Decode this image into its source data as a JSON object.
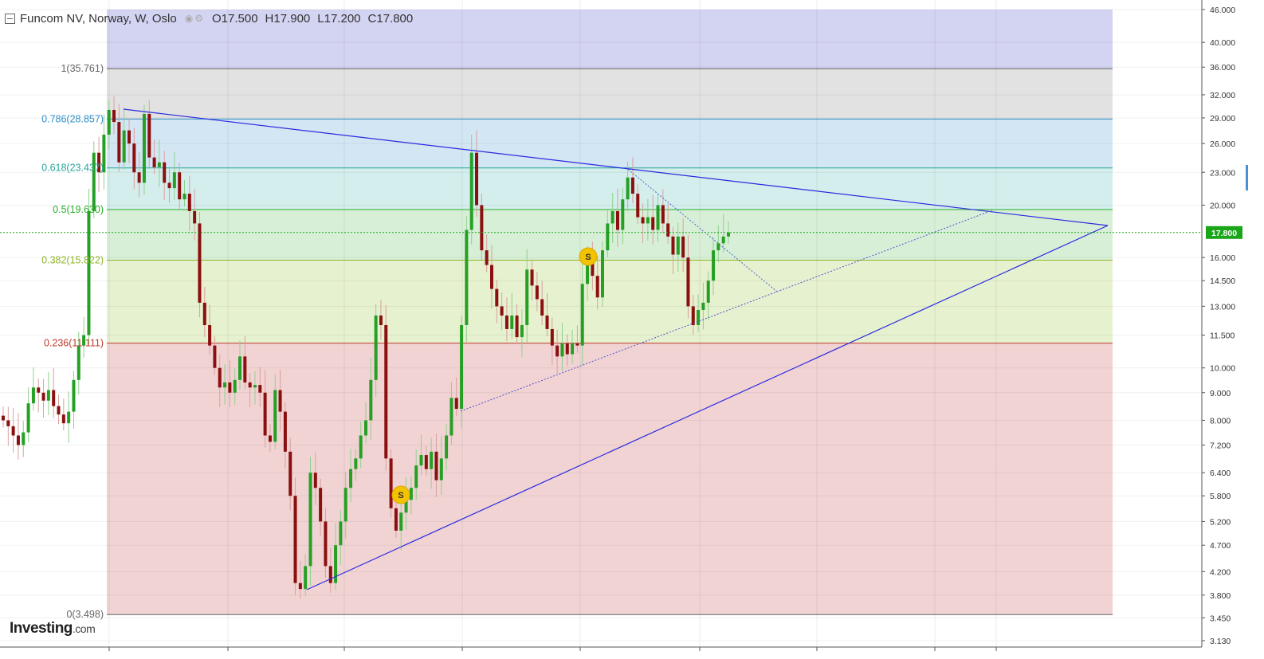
{
  "header": {
    "symbol": "Funcom NV, Norway, W, Oslo",
    "open_label": "O",
    "open": "17.500",
    "high_label": "H",
    "high": "17.900",
    "low_label": "L",
    "low": "17.200",
    "close_label": "C",
    "close": "17.800"
  },
  "branding": {
    "name": "Investing",
    "suffix": ".com"
  },
  "chart_data": {
    "type": "candlestick",
    "title": "Funcom NV, Norway, W, Oslo",
    "y_scale": "log",
    "ylim": [
      3.13,
      46.0
    ],
    "y_ticks": [
      "46.000",
      "40.000",
      "36.000",
      "32.000",
      "29.000",
      "26.000",
      "23.000",
      "20.000",
      "16.000",
      "14.500",
      "13.000",
      "11.500",
      "10.000",
      "9.000",
      "8.000",
      "7.200",
      "6.400",
      "5.800",
      "5.200",
      "4.700",
      "4.200",
      "3.800",
      "3.450",
      "3.130"
    ],
    "last_price": "17.800",
    "fibonacci": [
      {
        "label": "1(35.761)",
        "level": 35.761,
        "color": "#666666"
      },
      {
        "label": "0.786(28.857)",
        "level": 28.857,
        "color": "#2f8fc9"
      },
      {
        "label": "0.618(23.437)",
        "level": 23.437,
        "color": "#26a69a"
      },
      {
        "label": "0.5(19.630)",
        "level": 19.63,
        "color": "#27ae27"
      },
      {
        "label": "0.382(15.822)",
        "level": 15.822,
        "color": "#8fb528"
      },
      {
        "label": "0.236(11.111)",
        "level": 11.111,
        "color": "#c0392b"
      },
      {
        "label": "0(3.498)",
        "level": 3.498,
        "color": "#666666"
      }
    ],
    "fib_zones": [
      "#d3d3f2",
      "#e2e2e2",
      "#d3e6f3",
      "#d3eeec",
      "#d8efd7",
      "#e6f1cf",
      "#f1d3d3"
    ],
    "signals": [
      "S",
      "S"
    ],
    "series": [
      {
        "name": "Funcom NV",
        "weekly_closes": [
          8.0,
          7.8,
          7.5,
          7.2,
          7.6,
          8.6,
          9.2,
          9.0,
          8.7,
          9.1,
          8.5,
          8.2,
          7.9,
          8.3,
          9.5,
          11.0,
          11.5,
          19.5,
          25.0,
          23.0,
          27.0,
          30.0,
          28.5,
          24.0,
          27.5,
          26.0,
          23.0,
          22.0,
          29.5,
          24.5,
          23.5,
          24.0,
          22.0,
          21.5,
          23.0,
          20.5,
          21.0,
          19.5,
          18.5,
          13.2,
          12.0,
          11.0,
          10.0,
          9.2,
          9.4,
          9.0,
          9.5,
          10.5,
          9.4,
          9.2,
          9.3,
          9.0,
          7.5,
          7.3,
          9.1,
          8.3,
          7.0,
          5.8,
          4.0,
          3.9,
          4.3,
          6.4,
          6.0,
          5.2,
          4.3,
          4.0,
          4.7,
          5.2,
          6.0,
          6.5,
          6.8,
          7.5,
          8.0,
          9.5,
          12.5,
          12.0,
          6.8,
          5.5,
          5.0,
          5.4,
          5.7,
          6.0,
          6.6,
          6.9,
          6.5,
          7.0,
          6.2,
          6.8,
          7.5,
          8.8,
          8.4,
          12.0,
          18.0,
          25.0,
          20.0,
          16.5,
          15.5,
          14.0,
          13.0,
          12.5,
          11.8,
          12.5,
          11.4,
          12.0,
          15.2,
          14.2,
          13.4,
          12.5,
          11.8,
          11.0,
          10.5,
          11.1,
          10.6,
          11.1,
          11.0,
          14.3,
          16.0,
          14.8,
          13.5,
          16.5,
          18.5,
          19.5,
          18.0,
          20.5,
          22.5,
          21.0,
          19.0,
          18.5,
          19.0,
          18.0,
          20.0,
          18.5,
          17.5,
          16.2,
          17.5,
          16.0,
          13.0,
          12.0,
          12.8,
          13.2,
          14.5,
          16.5,
          17.0,
          17.5,
          17.8
        ]
      }
    ],
    "trendlines": [
      "upper resistance",
      "lower support",
      "dotted inner support",
      "dotted inner resistance"
    ]
  }
}
